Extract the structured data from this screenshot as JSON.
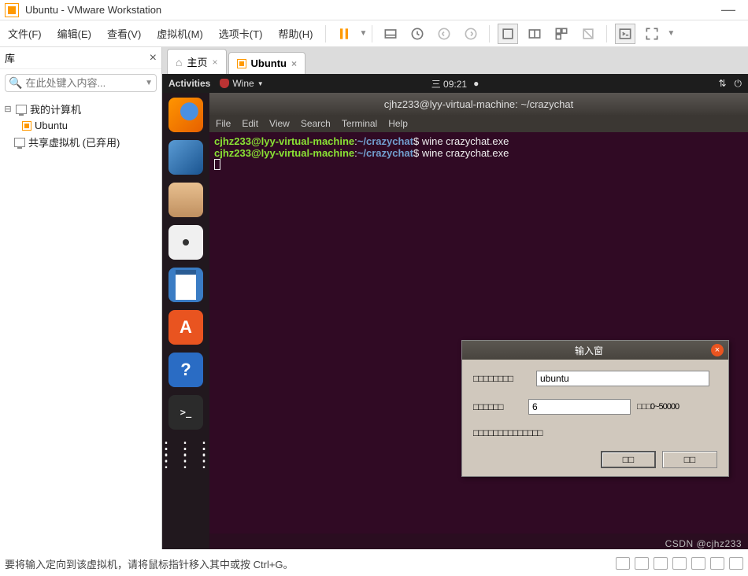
{
  "titlebar": {
    "text": "Ubuntu - VMware Workstation"
  },
  "menu": {
    "file": "文件(F)",
    "edit": "编辑(E)",
    "view": "查看(V)",
    "vm": "虚拟机(M)",
    "tabs": "选项卡(T)",
    "help": "帮助(H)"
  },
  "library": {
    "title": "库",
    "search_placeholder": "在此处键入内容...",
    "root": "我的计算机",
    "vm": "Ubuntu",
    "shared": "共享虚拟机 (已弃用)"
  },
  "tabs": {
    "home": "主页",
    "vm": "Ubuntu"
  },
  "ubuntu": {
    "activities": "Activities",
    "wine": "Wine",
    "clock": "三 09:21",
    "help_tooltip": "Help"
  },
  "terminal": {
    "title": "cjhz233@lyy-virtual-machine: ~/crazychat",
    "menu": {
      "file": "File",
      "edit": "Edit",
      "view": "View",
      "search": "Search",
      "terminal": "Terminal",
      "help": "Help"
    },
    "user": "cjhz233@lyy-virtual-machine",
    "colon": ":",
    "path": "~/crazychat",
    "prompt": "$",
    "cmd": "wine crazychat.exe"
  },
  "dialog": {
    "title": "输入窗",
    "field1_label": "□□□□□□□□",
    "field1_value": "ubuntu",
    "field2_label": "□□□□□□",
    "field2_value": "6",
    "field2_hint": "□□□0~50000",
    "field3_label": "□□□□□□□□□□□□□□",
    "ok": "□□",
    "cancel": "□□"
  },
  "status": {
    "text": "要将输入定向到该虚拟机，请将鼠标指针移入其中或按 Ctrl+G。"
  },
  "watermark": "CSDN @cjhz233"
}
